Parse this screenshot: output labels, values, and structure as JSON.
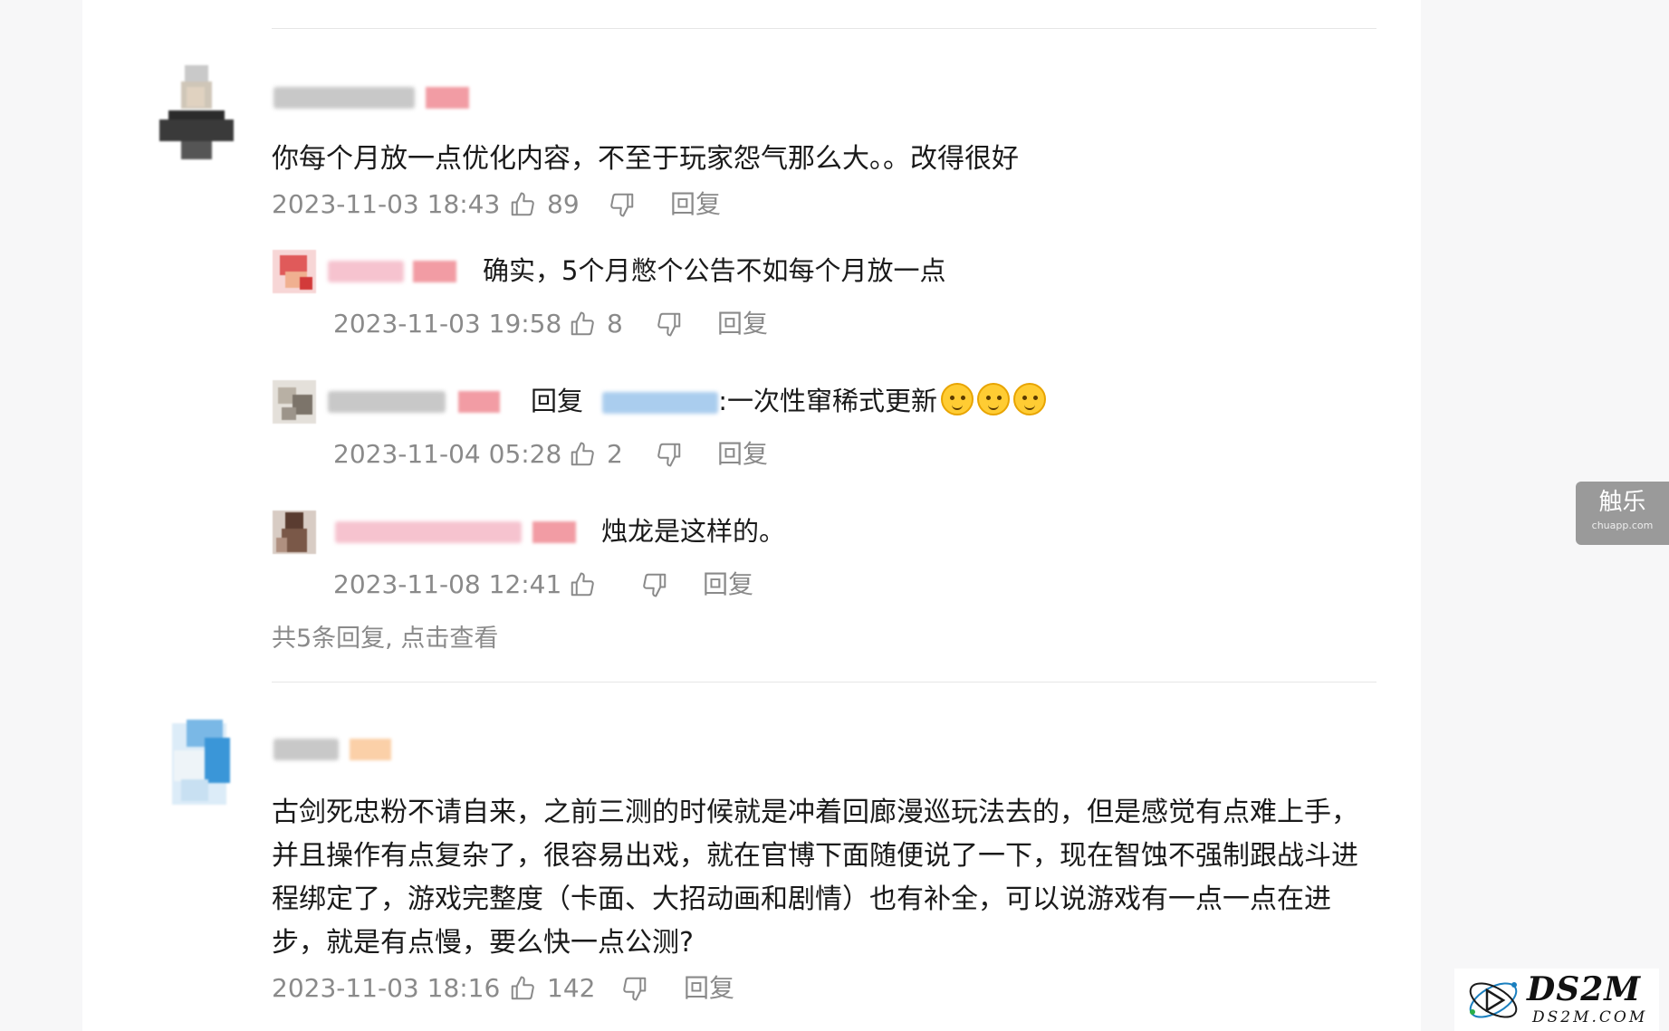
{
  "comments": [
    {
      "text": "你每个月放一点优化内容，不至于玩家怨气那么大。。改得很好",
      "time": "2023-11-03 18:43",
      "likes": "89",
      "reply_label": "回复",
      "replies": [
        {
          "text": "确实，5个月憋个公告不如每个月放一点",
          "time": "2023-11-03 19:58",
          "likes": "8",
          "reply_label": "回复"
        },
        {
          "reply_prefix": "回复",
          "text": ":一次性窜稀式更新",
          "time": "2023-11-04 05:28",
          "likes": "2",
          "reply_label": "回复"
        },
        {
          "text": "烛龙是这样的。",
          "time": "2023-11-08 12:41",
          "likes": "",
          "reply_label": "回复"
        }
      ],
      "more_replies": "共5条回复, 点击查看"
    },
    {
      "text_lines": [
        "古剑死忠粉不请自来，之前三测的时候就是冲着回廊漫巡玩法去的，但是感觉有点难上手，",
        "并且操作有点复杂了，很容易出戏，就在官博下面随便说了一下，现在智蚀不强制跟战斗进",
        "程绑定了，游戏完整度（卡面、大招动画和剧情）也有补全，可以说游戏有一点一点在进",
        "步，就是有点慢，要么快一点公测?"
      ],
      "time": "2023-11-03 18:16",
      "likes": "142",
      "reply_label": "回复"
    }
  ],
  "side_badge": {
    "title": "触乐",
    "subtitle": "chuapp.com"
  },
  "watermark": {
    "brand": "DS2M",
    "url": "DS2M.COM"
  },
  "icons": {
    "like": "thumbs-up-icon",
    "dislike": "thumbs-down-icon",
    "emoji": "cat-face-emoji-icon"
  },
  "colors": {
    "meta_text": "#8a8a8a",
    "body_text": "#1a1a1a",
    "divider": "#e6e6e6",
    "badge_bg": "#9a9a9a"
  }
}
